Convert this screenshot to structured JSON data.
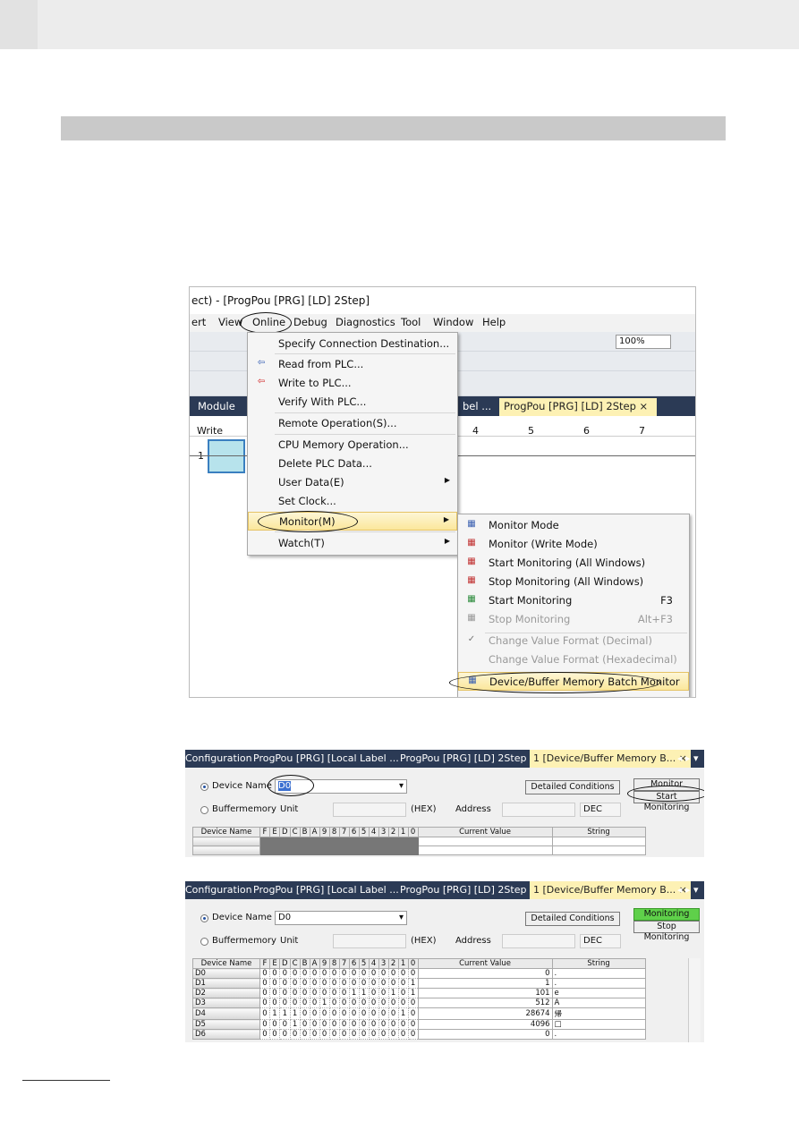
{
  "screenshot1": {
    "title": "ect) - [ProgPou [PRG] [LD] 2Step]",
    "menubar": [
      "ert",
      "View",
      "Online",
      "Debug",
      "Diagnostics",
      "Tool",
      "Window",
      "Help"
    ],
    "zoom": "100%",
    "tabs": [
      "Module",
      "bel ...",
      "ProgPou [PRG] [LD] 2Step ×"
    ],
    "grid_header": [
      "Write",
      "4",
      "5",
      "6",
      "7"
    ],
    "row_number": "1",
    "online_menu": [
      {
        "label": "Specify Connection Destination..."
      },
      {
        "label": "Read from PLC...",
        "icon": "read-from-plc-icon"
      },
      {
        "label": "Write to PLC...",
        "icon": "write-to-plc-icon"
      },
      {
        "label": "Verify With PLC..."
      },
      {
        "label": "Remote Operation(S)..."
      },
      {
        "label": "CPU Memory Operation..."
      },
      {
        "label": "Delete PLC Data..."
      },
      {
        "label": "User Data(E)",
        "submenu": true
      },
      {
        "label": "Set Clock..."
      },
      {
        "label": "Monitor(M)",
        "submenu": true,
        "highlighted": true
      },
      {
        "label": "Watch(T)",
        "submenu": true
      }
    ],
    "monitor_submenu": [
      {
        "label": "Monitor Mode",
        "icon": "monitor-mode-icon"
      },
      {
        "label": "Monitor (Write Mode)",
        "icon": "monitor-write-mode-icon"
      },
      {
        "label": "Start Monitoring (All Windows)",
        "icon": "start-monitoring-all-icon"
      },
      {
        "label": "Stop Monitoring (All Windows)",
        "icon": "stop-monitoring-all-icon"
      },
      {
        "label": "Start Monitoring",
        "shortcut": "F3",
        "icon": "start-monitoring-icon"
      },
      {
        "label": "Stop Monitoring",
        "shortcut": "Alt+F3",
        "disabled": true,
        "icon": "stop-monitoring-icon"
      },
      {
        "label": "Change Value Format (Decimal)",
        "disabled": true,
        "checked": true
      },
      {
        "label": "Change Value Format (Hexadecimal)",
        "disabled": true
      },
      {
        "label": "Device/Buffer Memory Batch Monitor",
        "highlighted": true,
        "icon": "batch-monitor-icon"
      }
    ]
  },
  "device_monitor": {
    "tabs": [
      "Configuration",
      "ProgPou [PRG] [Local Label ...",
      "ProgPou [PRG] [LD] 2Step",
      "1 [Device/Buffer Memory B...  ×"
    ],
    "device_name_label": "Device Name",
    "device_name_value": "D0",
    "buffer_label": "Buffermemory",
    "unit_label": "Unit",
    "hex_label": "(HEX)",
    "address_label": "Address",
    "dec_value": "DEC",
    "detailed_conditions": "Detailed Conditions",
    "columns": [
      "Device Name",
      "F",
      "E",
      "D",
      "C",
      "B",
      "A",
      "9",
      "8",
      "7",
      "6",
      "5",
      "4",
      "3",
      "2",
      "1",
      "0",
      "Current Value",
      "String"
    ]
  },
  "before": {
    "status": "Monitor stopping",
    "button": "Start Monitoring"
  },
  "after": {
    "status": "Monitoring",
    "button": "Stop Monitoring",
    "rows": [
      {
        "device": "D0",
        "bits": "0000000000000000",
        "value": "0",
        "string": "."
      },
      {
        "device": "D1",
        "bits": "0000000000000001",
        "value": "1",
        "string": "."
      },
      {
        "device": "D2",
        "bits": "0000000001100101",
        "value": "101",
        "string": "e"
      },
      {
        "device": "D3",
        "bits": "0000001000000000",
        "value": "512",
        "string": "A"
      },
      {
        "device": "D4",
        "bits": "0111000000000010",
        "value": "28674",
        "string": "帰"
      },
      {
        "device": "D5",
        "bits": "0001000000000000",
        "value": "4096",
        "string": "□"
      },
      {
        "device": "D6",
        "bits": "0000000000000000",
        "value": "0",
        "string": "."
      }
    ]
  },
  "colors": {
    "tab_bar": "#2b3a55",
    "active_tab": "#fdf1b4",
    "monitoring": "#5fd04a",
    "section_bar": "#c9c9c9"
  }
}
